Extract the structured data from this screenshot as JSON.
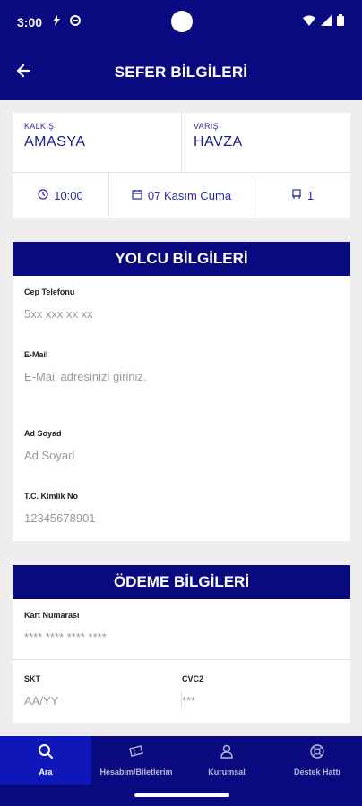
{
  "status_bar": {
    "time": "3:00",
    "icons": [
      "data-saver-icon",
      "vpn-key-icon",
      "wifi-icon",
      "signal-icon",
      "battery-icon"
    ]
  },
  "app_bar": {
    "title": "SEFER BİLGİLERİ",
    "back_icon": "arrow-left-icon"
  },
  "trip": {
    "departure_label": "KALKIŞ",
    "departure_value": "AMASYA",
    "arrival_label": "VARIŞ",
    "arrival_value": "HAVZA",
    "time": "10:00",
    "date": "07 Kasım Cuma",
    "seat": "1"
  },
  "passenger": {
    "header": "YOLCU BİLGİLERİ",
    "phone_label": "Cep Telefonu",
    "phone_placeholder": "5xx xxx xx xx",
    "email_label": "E-Mail",
    "email_placeholder": "E-Mail adresinizi giriniz.",
    "name_label": "Ad Soyad",
    "name_placeholder": "Ad Soyad",
    "tc_label": "T.C. Kimlik No",
    "tc_placeholder": "12345678901"
  },
  "payment": {
    "header": "ÖDEME BİLGİLERİ",
    "card_label": "Kart Numarası",
    "card_placeholder": "**** **** **** ****",
    "expiry_label": "SKT",
    "expiry_placeholder": "AA/YY",
    "cvc_label": "CVC2",
    "cvc_placeholder": "***"
  },
  "bottom_nav": [
    {
      "label": "Ara",
      "icon": "search-icon",
      "active": true
    },
    {
      "label": "Hesabım/Biletlerim",
      "icon": "ticket-icon",
      "active": false
    },
    {
      "label": "Kurumsal",
      "icon": "person-icon",
      "active": false
    },
    {
      "label": "Destek Hattı",
      "icon": "support-icon",
      "active": false
    }
  ],
  "colors": {
    "primary": "#0a0a80",
    "active_nav": "#0f17b8",
    "accent_text": "#2a2aa0",
    "background": "#eeeeee"
  }
}
